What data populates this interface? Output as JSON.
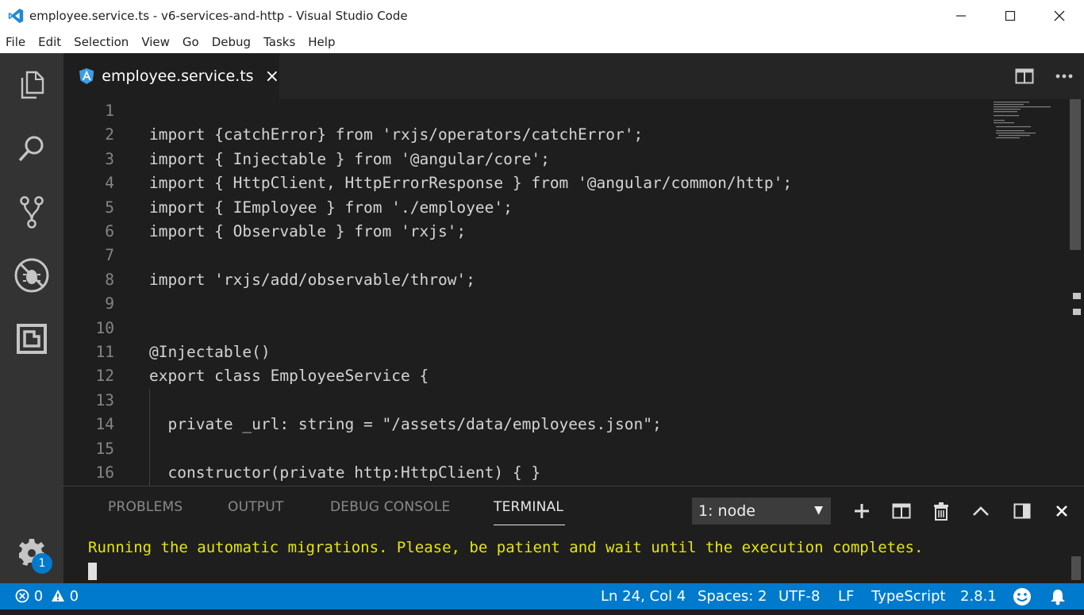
{
  "window": {
    "title": "employee.service.ts - v6-services-and-http - Visual Studio Code",
    "minimize": "—",
    "maximize": "☐",
    "close": "✕"
  },
  "menu": [
    "File",
    "Edit",
    "Selection",
    "View",
    "Go",
    "Debug",
    "Tasks",
    "Help"
  ],
  "activity_bar": {
    "items": [
      "explorer-icon",
      "search-icon",
      "source-control-icon",
      "debug-icon",
      "extensions-icon"
    ],
    "settings_badge": "1"
  },
  "tab": {
    "label": "employee.service.ts",
    "close": "×",
    "icon": "angular-icon"
  },
  "editor": {
    "lines": [
      {
        "n": "1",
        "text": ""
      },
      {
        "n": "2",
        "text": "import {catchError} from 'rxjs/operators/catchError';"
      },
      {
        "n": "3",
        "text": "import { Injectable } from '@angular/core';"
      },
      {
        "n": "4",
        "text": "import { HttpClient, HttpErrorResponse } from '@angular/common/http';"
      },
      {
        "n": "5",
        "text": "import { IEmployee } from './employee';"
      },
      {
        "n": "6",
        "text": "import { Observable } from 'rxjs';"
      },
      {
        "n": "7",
        "text": ""
      },
      {
        "n": "8",
        "text": "import 'rxjs/add/observable/throw';"
      },
      {
        "n": "9",
        "text": ""
      },
      {
        "n": "10",
        "text": ""
      },
      {
        "n": "11",
        "text": "@Injectable()"
      },
      {
        "n": "12",
        "text": "export class EmployeeService {"
      },
      {
        "n": "13",
        "text": ""
      },
      {
        "n": "14",
        "text": "  private _url: string = \"/assets/data/employees.json\";"
      },
      {
        "n": "15",
        "text": ""
      },
      {
        "n": "16",
        "text": "  constructor(private http:HttpClient) { }"
      }
    ]
  },
  "panel": {
    "tabs": [
      "PROBLEMS",
      "OUTPUT",
      "DEBUG CONSOLE",
      "TERMINAL"
    ],
    "active_tab": "TERMINAL",
    "terminal_select": "1: node",
    "terminal_output": "Running the automatic migrations. Please, be patient and wait until the execution completes."
  },
  "status": {
    "errors": "0",
    "warnings": "0",
    "position": "Ln 24, Col 4",
    "spaces": "Spaces: 2",
    "encoding": "UTF-8",
    "eol": "LF",
    "language": "TypeScript",
    "version": "2.8.1"
  },
  "colors": {
    "accent": "#007acc",
    "terminal_text": "#e5e510",
    "editor_bg": "#1e1e1e",
    "activity_bg": "#333333"
  }
}
